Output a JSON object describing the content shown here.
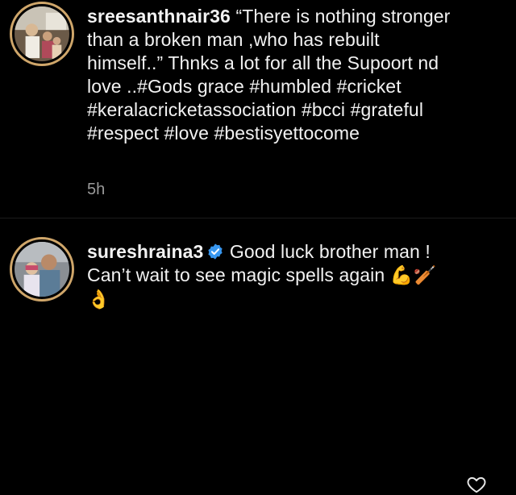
{
  "caption": {
    "username": "sreesanthnair36",
    "text": "“There is nothing stronger than a broken man ,who has rebuilt himself..” Thnks a lot for all the Supoort nd love ..#Gods grace #humbled #cricket #keralacricketassociation #bcci #grateful #respect #love #bestisyettocome",
    "timestamp": "5h"
  },
  "comment": {
    "username": "sureshraina3",
    "text": "Good luck brother man ! Can’t wait to see magic spells again",
    "emojis": "💪🏏👌",
    "verified_icon": "verified-badge-icon",
    "like_icon": "heart-outline-icon"
  },
  "colors": {
    "background": "#000000",
    "text": "#f2f2f2",
    "muted": "#9a9a9a",
    "verified": "#3897f0",
    "avatar_ring": "#cfa66a"
  }
}
